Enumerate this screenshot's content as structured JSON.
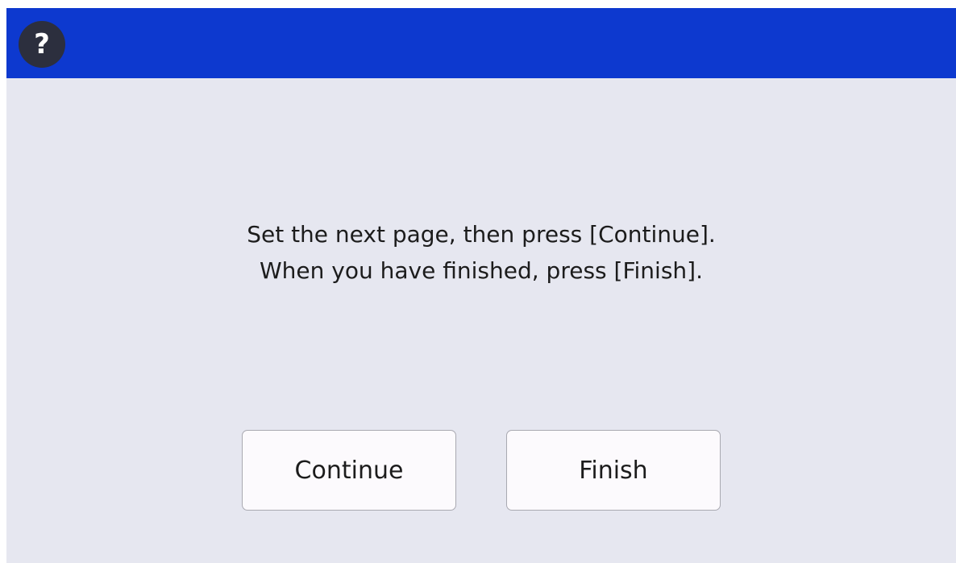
{
  "header": {
    "help_icon": "question-mark-icon",
    "help_glyph": "?",
    "background_color": "#0d39cf"
  },
  "message": {
    "line1": "Set the next page, then press [Continue].",
    "line2": "When you have finished, press [Finish]."
  },
  "buttons": {
    "continue_label": "Continue",
    "finish_label": "Finish"
  },
  "colors": {
    "panel_background": "#e6e7f0",
    "button_background": "#fcfafd",
    "text": "#1c1c1c"
  }
}
